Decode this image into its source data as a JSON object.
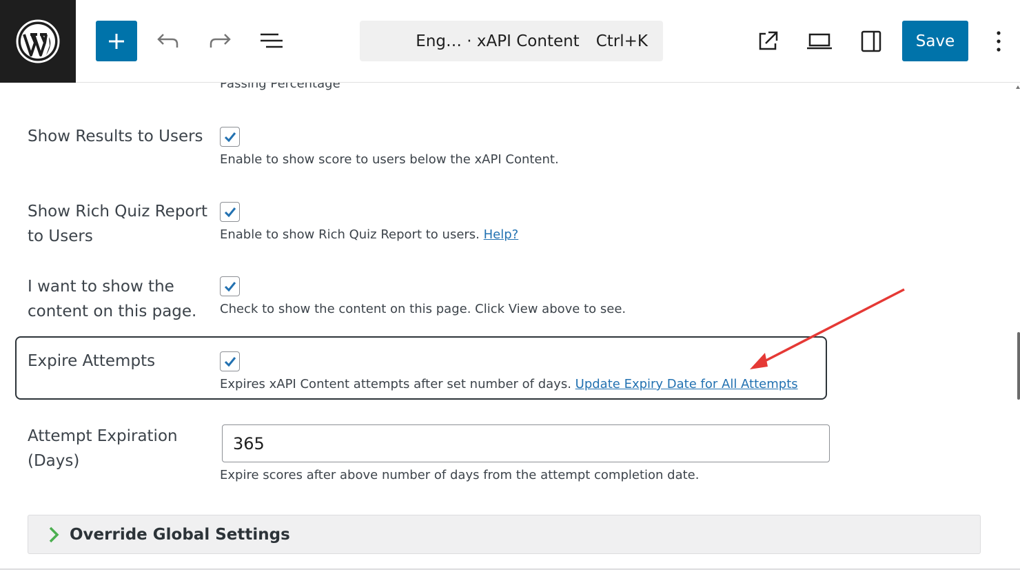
{
  "toolbar": {
    "wp_logo_icon": "wordpress-logo",
    "add_icon": "plus-icon",
    "undo_icon": "undo-icon",
    "redo_icon": "redo-icon",
    "document_overview_icon": "list-view-icon",
    "command_center": {
      "title": "Eng… · xAPI Content",
      "shortcut": "Ctrl+K"
    },
    "view_icon": "external-link-icon",
    "preview_icon": "desktop-preview-icon",
    "settings_icon": "sidebar-toggle-icon",
    "save_label": "Save",
    "options_icon": "more-vertical-icon",
    "accent_color": "#0073aa"
  },
  "settings": {
    "passing_percentage_label": "Passing Percentage",
    "show_results": {
      "label": "Show Results to Users",
      "checked": true,
      "description": "Enable to show score to users below the xAPI Content."
    },
    "rich_quiz_report": {
      "label": "Show Rich Quiz Report to Users",
      "checked": true,
      "description": "Enable to show Rich Quiz Report to users.",
      "link_text": "Help?"
    },
    "show_content": {
      "label": "I want to show the content on this page.",
      "checked": true,
      "description": "Check to show the content on this page. Click View above to see."
    },
    "expire_attempts": {
      "label": "Expire Attempts",
      "checked": true,
      "description": "Expires xAPI Content attempts after set number of days.",
      "link_text": "Update Expiry Date for All Attempts"
    },
    "attempt_expiration": {
      "label": "Attempt Expiration (Days)",
      "value": "365",
      "description": "Expire scores after above number of days from the attempt completion date."
    },
    "override_global": {
      "label": "Override Global Settings",
      "icon": "chevron-right-icon"
    }
  },
  "annotation": {
    "arrow_color": "#e53935"
  }
}
